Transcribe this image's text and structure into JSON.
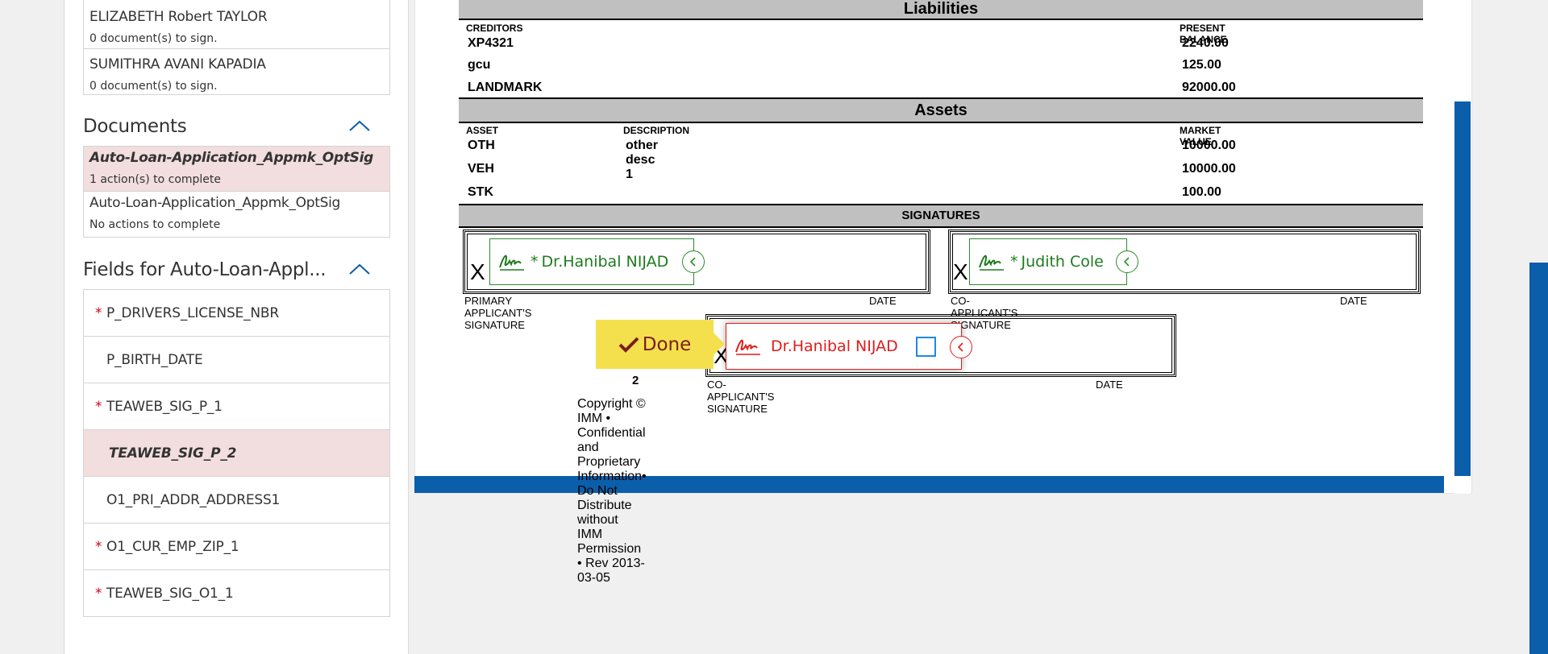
{
  "signers": [
    {
      "name": "ELIZABETH Robert TAYLOR",
      "status": "0 document(s) to sign."
    },
    {
      "name": "SUMITHRA AVANI KAPADIA",
      "status": "0 document(s) to sign."
    }
  ],
  "documents_section": {
    "title": "Documents",
    "items": [
      {
        "name": "Auto-Loan-Application_Appmk_OptSig",
        "status": "1 action(s) to complete",
        "selected": true
      },
      {
        "name": "Auto-Loan-Application_Appmk_OptSig",
        "status": "No actions to complete",
        "selected": false
      }
    ]
  },
  "fields_section": {
    "title": "Fields for Auto-Loan-Appl...",
    "items": [
      {
        "name": "P_DRIVERS_LICENSE_NBR",
        "required": true
      },
      {
        "name": "P_BIRTH_DATE",
        "required": false
      },
      {
        "name": "TEAWEB_SIG_P_1",
        "required": true
      },
      {
        "name": "TEAWEB_SIG_P_2",
        "required": false,
        "selected": true
      },
      {
        "name": "O1_PRI_ADDR_ADDRESS1",
        "required": false
      },
      {
        "name": "O1_CUR_EMP_ZIP_1",
        "required": true
      },
      {
        "name": "TEAWEB_SIG_O1_1",
        "required": true
      }
    ],
    "required_mark": "*"
  },
  "form": {
    "liabilities": {
      "title": "Liabilities",
      "col1": "CREDITORS",
      "col2": "PRESENT BALANCE",
      "rows": [
        {
          "creditor": "XP4321",
          "balance": "2240.00"
        },
        {
          "creditor": "gcu",
          "balance": "125.00"
        },
        {
          "creditor": "LANDMARK",
          "balance": "92000.00"
        }
      ]
    },
    "assets": {
      "title": "Assets",
      "col1": "ASSET",
      "col2": "DESCRIPTION",
      "col3": "MARKET VALUE",
      "rows": [
        {
          "asset": "OTH",
          "description": "other desc 1",
          "value": "10000.00"
        },
        {
          "asset": "VEH",
          "description": "",
          "value": "10000.00"
        },
        {
          "asset": "STK",
          "description": "",
          "value": "100.00"
        }
      ]
    },
    "signatures": {
      "title": "SIGNATURES",
      "x": "X",
      "primary_label": "PRIMARY APPLICANT'S SIGNATURE",
      "co_label": "CO-APPLICANT'S SIGNATURE",
      "date_label": "DATE",
      "sig1": "Dr.Hanibal NIJAD",
      "sig2": "Judith Cole",
      "sig3": "Dr.Hanibal NIJAD",
      "req": "*",
      "page_number": "2"
    },
    "copyright": "Copyright © IMM • Confidential and Proprietary Information• Do Not Distribute without IMM Permission • Rev 2013-03-05"
  },
  "done_button": {
    "label": "Done"
  },
  "colors": {
    "accent": "#0b5eaa",
    "highlight": "#f2dede",
    "done_bg": "#f4e04d",
    "sig_green": "#1e7b1e",
    "sig_red": "#e01c1c"
  }
}
